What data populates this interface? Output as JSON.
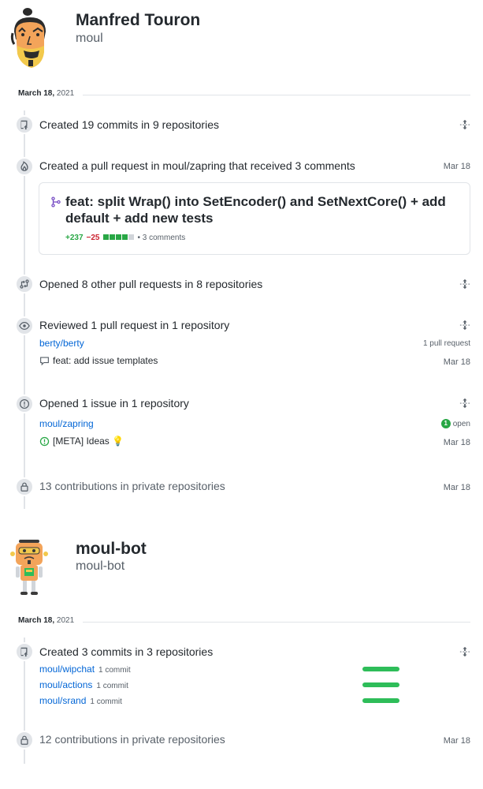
{
  "profiles": [
    {
      "name": "Manfred Touron",
      "login": "moul",
      "date": {
        "month_day": "March 18,",
        "year": "2021"
      },
      "events": {
        "commits": {
          "title": "Created 19 commits in 9 repositories"
        },
        "pull_request": {
          "title": "Created a pull request in moul/zapring that received 3 comments",
          "date": "Mar 18",
          "card": {
            "title": "feat: split Wrap() into SetEncoder() and SetNextCore() + add default + add new tests",
            "additions": "+237",
            "deletions": "−25",
            "diff_colors": [
              "#28a745",
              "#28a745",
              "#28a745",
              "#28a745",
              "#d1d5da"
            ],
            "comments": "• 3 comments"
          }
        },
        "other_prs": {
          "title": "Opened 8 other pull requests in 8 repositories"
        },
        "reviewed": {
          "title": "Reviewed 1 pull request in 1 repository",
          "repo": "berty/berty",
          "repo_count": "1 pull request",
          "item": "feat: add issue templates",
          "item_date": "Mar 18"
        },
        "issue": {
          "title": "Opened 1 issue in 1 repository",
          "repo": "moul/zapring",
          "open_count": "1",
          "open_label": "open",
          "item": "[META] Ideas 💡",
          "item_date": "Mar 18"
        },
        "private": {
          "title": "13 contributions in private repositories",
          "date": "Mar 18"
        }
      }
    },
    {
      "name": "moul-bot",
      "login": "moul-bot",
      "date": {
        "month_day": "March 18,",
        "year": "2021"
      },
      "events": {
        "commits": {
          "title": "Created 3 commits in 3 repositories",
          "repos": [
            {
              "name": "moul/wipchat",
              "count": "1 commit",
              "share": 1
            },
            {
              "name": "moul/actions",
              "count": "1 commit",
              "share": 1
            },
            {
              "name": "moul/srand",
              "count": "1 commit",
              "share": 1
            }
          ]
        },
        "private": {
          "title": "12 contributions in private repositories",
          "date": "Mar 18"
        }
      }
    }
  ],
  "icons": {
    "avatar_1": "illustrated-man-avatar",
    "avatar_2": "robot-avatar",
    "commit": "repo-push-icon",
    "pull_request": "flame-icon",
    "other_prs": "git-compare-icon",
    "reviewed": "eye-icon",
    "issue": "issue-opened-icon",
    "private": "lock-icon",
    "fold": "unfold-icon",
    "pr_card": "git-pull-request-icon",
    "comment": "comment-icon"
  },
  "colors": {
    "link": "#0366d6",
    "green": "#28a745",
    "red": "#cb2431",
    "bar": "#2ebd59",
    "muted": "#586069"
  }
}
